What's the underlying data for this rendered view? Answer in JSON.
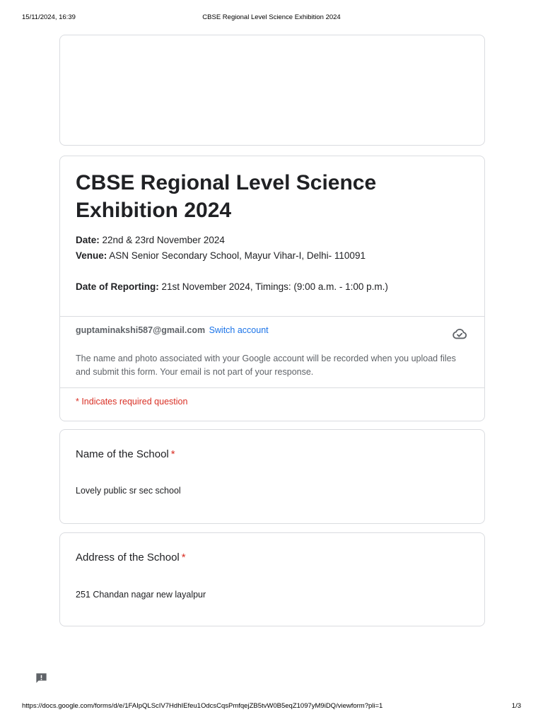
{
  "print_header": {
    "datetime": "15/11/2024, 16:39",
    "page_title": "CBSE Regional Level Science Exhibition 2024"
  },
  "form": {
    "title": "CBSE Regional Level Science Exhibition 2024",
    "description": {
      "date_label": "Date:",
      "date_value": " 22nd & 23rd November 2024",
      "venue_label": "Venue:",
      "venue_value": " ASN Senior Secondary School, Mayur Vihar-I, Delhi- 110091",
      "reporting_label": "Date of Reporting:",
      "reporting_value": " 21st November 2024,  Timings: (9:00 a.m. - 1:00 p.m.)"
    },
    "account": {
      "email": "guptaminakshi587@gmail.com",
      "switch_label": "Switch account",
      "note": "The name and photo associated with your Google account will be recorded when you upload files and submit this form. Your email is not part of your response.",
      "cloud_icon": "cloud-done-icon"
    },
    "required_note": "* Indicates required question"
  },
  "questions": [
    {
      "title": "Name of the School",
      "required_mark": "*",
      "answer": "Lovely public sr sec school"
    },
    {
      "title": "Address of the School",
      "required_mark": "*",
      "answer": "251 Chandan nagar new layalpur"
    }
  ],
  "feedback_icon": "report-feedback-icon",
  "print_footer": {
    "url": "https://docs.google.com/forms/d/e/1FAIpQLScIV7HdhIEfeu1OdcsCqsPmfqejZB5tvW0B5eqZ1097yM9iDQ/viewform?pli=1",
    "page": "1/3"
  },
  "colors": {
    "link": "#1a73e8",
    "required": "#d93025",
    "border": "#dadce0",
    "muted_text": "#5f6368"
  }
}
